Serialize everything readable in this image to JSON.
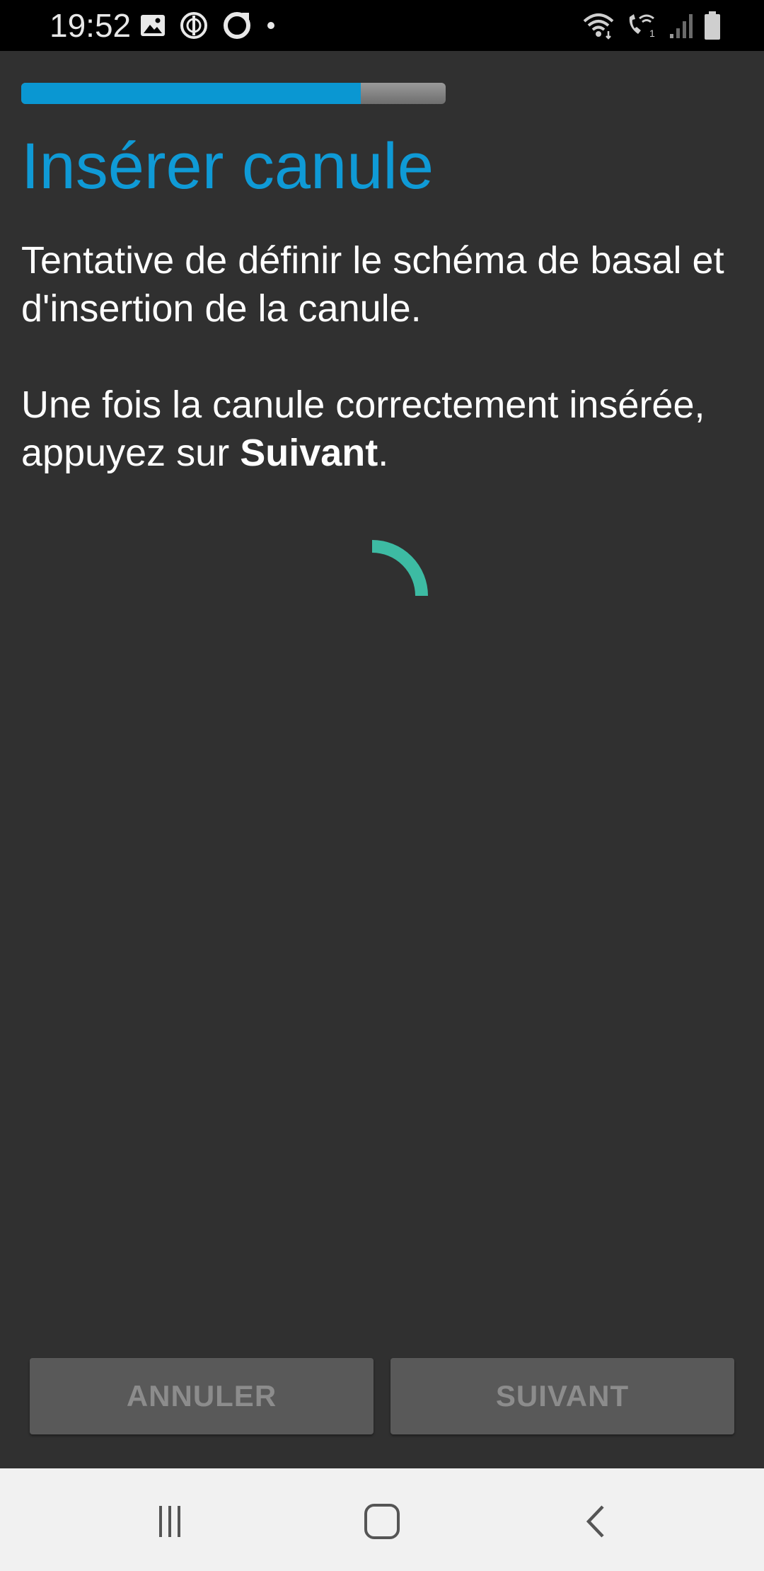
{
  "status_bar": {
    "time": "19:52",
    "left_icons": [
      "image-icon",
      "sync-icon",
      "ring-icon",
      "dot-icon"
    ],
    "right_icons": [
      "wifi-icon",
      "wifi-call-icon",
      "signal-icon",
      "battery-icon"
    ],
    "wifi_call_sim": "1"
  },
  "wizard": {
    "progress": 0.8,
    "title": "Insérer canule",
    "paragraph_1": "Tentative de définir le schéma de basal et d'insertion de la canule.",
    "paragraph_2_prefix": "Une fois la canule correctement insérée, appuyez sur ",
    "paragraph_2_bold": "Suivant",
    "paragraph_2_suffix": ".",
    "colors": {
      "accent": "#0f9ad6",
      "progress_fill": "#0a97d2",
      "spinner": "#3dbba3",
      "background": "#303030",
      "button_bg": "#595959",
      "button_text": "#8c8c8c"
    }
  },
  "buttons": {
    "cancel_label": "ANNULER",
    "next_label": "SUIVANT"
  },
  "nav_bar": {
    "icons": [
      "recents-icon",
      "home-icon",
      "back-icon"
    ]
  }
}
